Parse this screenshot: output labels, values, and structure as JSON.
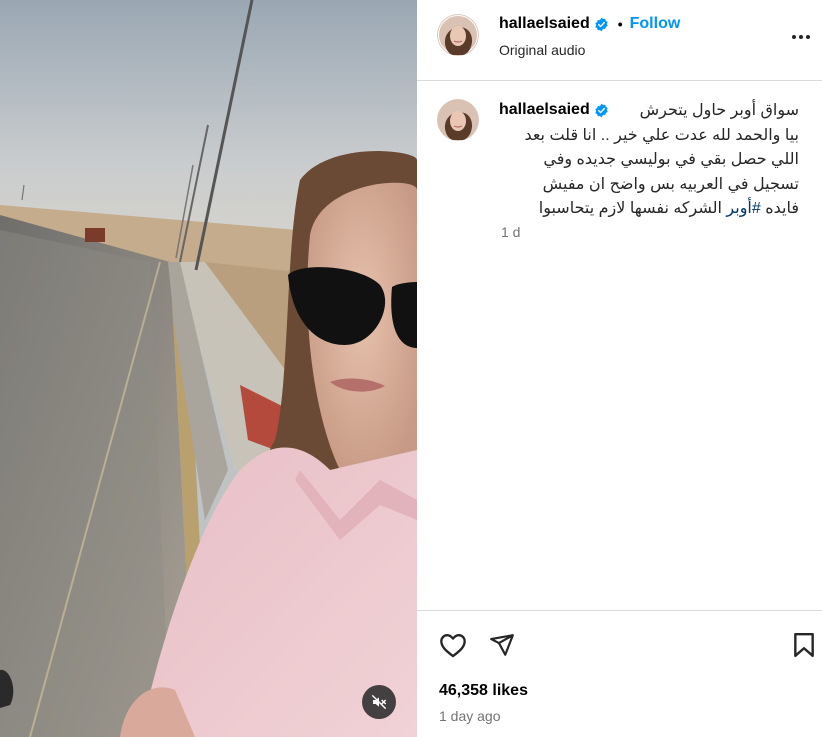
{
  "post": {
    "username": "hallaelsaied",
    "follow_label": "Follow",
    "separator": "•",
    "audio_label": "Original audio",
    "caption_line1": "سواق أوبر حاول يتحرش",
    "caption_line2": "بيا والحمد لله عدت علي خير .. انا قلت بعد",
    "caption_line3": "اللي حصل بقي في بوليسي جديده وفي",
    "caption_line4": "تسجيل في العربيه بس واضح ان مفيش",
    "caption_line5_start": "فايده",
    "hashtag": "#أوبر",
    "caption_line5_end": "الشركه نفسها لازم يتحاسبوا",
    "caption_time": "1 d",
    "likes": "46,358 likes",
    "posted_ago": "1 day ago"
  },
  "icons": {
    "verified": "verified-badge-icon",
    "more": "more-options-icon",
    "like": "heart-icon",
    "share": "share-icon",
    "save": "bookmark-icon",
    "mute": "muted-speaker-icon"
  },
  "colors": {
    "accent": "#0095f6",
    "hashtag": "#00376b",
    "secondary_text": "#737373",
    "divider": "#dbdbdb"
  }
}
